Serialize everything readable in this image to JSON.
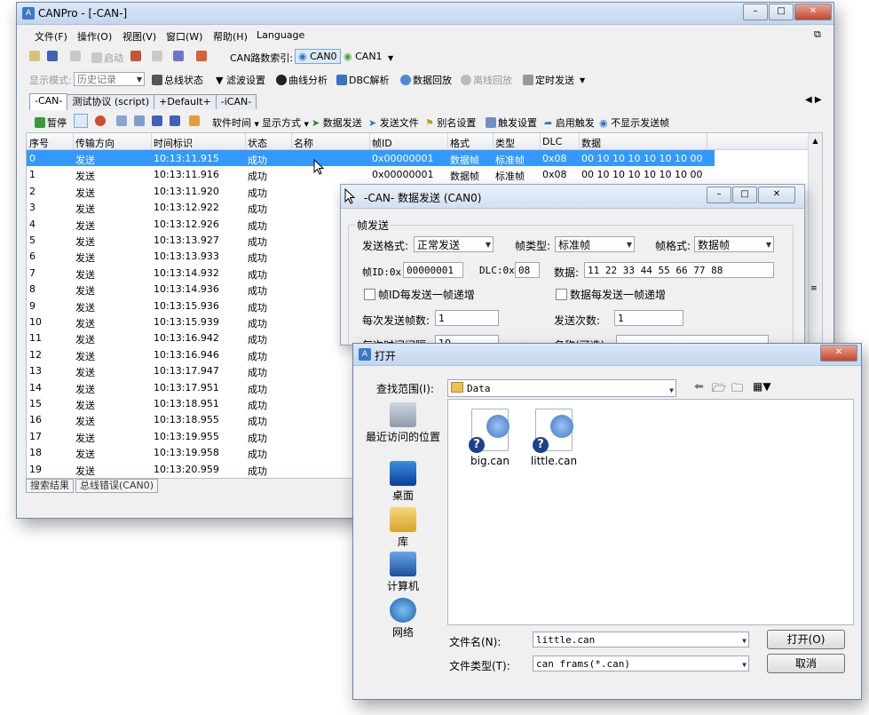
{
  "main": {
    "title": "CANPro - [-CAN-]",
    "menu": [
      "文件(F)",
      "操作(O)",
      "视图(V)",
      "窗口(W)",
      "帮助(H)",
      "Language"
    ],
    "toolbar1": {
      "start": "启动",
      "can_index_label": "CAN路数索引:",
      "can0": "CAN0",
      "can1": "CAN1"
    },
    "toolbar2": {
      "display_mode_label": "显示模式:",
      "display_mode_value": "历史记录",
      "bus_status": "总线状态",
      "filter": "滤波设置",
      "curve": "曲线分析",
      "dbc": "DBC解析",
      "replay": "数据回放",
      "offline_replay": "离线回放",
      "timed_send": "定时发送"
    },
    "tabs": [
      "-CAN-",
      "测试协议 (script)",
      "+Default+",
      "-iCAN-"
    ],
    "toolbar3": {
      "pause": "暂停",
      "soft_time": "软件时间",
      "display_style": "显示方式",
      "send_data": "数据发送",
      "send_file": "发送文件",
      "alias": "别名设置",
      "trigger": "触发设置",
      "enable_trigger": "启用触发",
      "hide_send": "不显示发送帧"
    },
    "columns": [
      "序号",
      "传输方向",
      "时间标识",
      "状态",
      "名称",
      "帧ID",
      "格式",
      "类型",
      "DLC",
      "数据"
    ],
    "rows": [
      {
        "no": "0",
        "dir": "发送",
        "time": "10:13:11.915",
        "status": "成功",
        "id": "0x00000001",
        "fmt": "数据帧",
        "type": "标准帧",
        "dlc": "0x08",
        "data": "00 10 10 10 10 10 10 00"
      },
      {
        "no": "1",
        "dir": "发送",
        "time": "10:13:11.916",
        "status": "成功",
        "id": "0x00000001",
        "fmt": "数据帧",
        "type": "标准帧",
        "dlc": "0x08",
        "data": "00 10 10 10 10 10 10 00"
      },
      {
        "no": "2",
        "dir": "发送",
        "time": "10:13:11.920",
        "status": "成功"
      },
      {
        "no": "3",
        "dir": "发送",
        "time": "10:13:12.922",
        "status": "成功"
      },
      {
        "no": "4",
        "dir": "发送",
        "time": "10:13:12.926",
        "status": "成功"
      },
      {
        "no": "5",
        "dir": "发送",
        "time": "10:13:13.927",
        "status": "成功"
      },
      {
        "no": "6",
        "dir": "发送",
        "time": "10:13:13.933",
        "status": "成功"
      },
      {
        "no": "7",
        "dir": "发送",
        "time": "10:13:14.932",
        "status": "成功"
      },
      {
        "no": "8",
        "dir": "发送",
        "time": "10:13:14.936",
        "status": "成功"
      },
      {
        "no": "9",
        "dir": "发送",
        "time": "10:13:15.936",
        "status": "成功"
      },
      {
        "no": "10",
        "dir": "发送",
        "time": "10:13:15.939",
        "status": "成功"
      },
      {
        "no": "11",
        "dir": "发送",
        "time": "10:13:16.942",
        "status": "成功"
      },
      {
        "no": "12",
        "dir": "发送",
        "time": "10:13:16.946",
        "status": "成功"
      },
      {
        "no": "13",
        "dir": "发送",
        "time": "10:13:17.947",
        "status": "成功"
      },
      {
        "no": "14",
        "dir": "发送",
        "time": "10:13:17.951",
        "status": "成功"
      },
      {
        "no": "15",
        "dir": "发送",
        "time": "10:13:18.951",
        "status": "成功"
      },
      {
        "no": "16",
        "dir": "发送",
        "time": "10:13:18.955",
        "status": "成功"
      },
      {
        "no": "17",
        "dir": "发送",
        "time": "10:13:19.955",
        "status": "成功"
      },
      {
        "no": "18",
        "dir": "发送",
        "time": "10:13:19.958",
        "status": "成功"
      },
      {
        "no": "19",
        "dir": "发送",
        "time": "10:13:20.959",
        "status": "成功"
      }
    ],
    "bottom_tabs": [
      "搜索结果",
      "总线错误(CAN0)"
    ]
  },
  "send_dialog": {
    "title": "-CAN- 数据发送 (CAN0)",
    "group": "帧发送",
    "send_format_label": "发送格式:",
    "send_format": "正常发送",
    "frame_type_label": "帧类型:",
    "frame_type": "标准帧",
    "frame_format_label": "帧格式:",
    "frame_format": "数据帧",
    "frame_id_label": "帧ID:0x",
    "frame_id": "00000001",
    "dlc_label": "DLC:0x",
    "dlc": "08",
    "data_label": "数据:",
    "data": "11 22 33 44 55 66 77 88",
    "inc_id": "帧ID每发送一帧递增",
    "inc_data": "数据每发送一帧递增",
    "frames_per_send_label": "每次发送帧数:",
    "frames_per_send": "1",
    "send_count_label": "发送次数:",
    "send_count": "1",
    "interval_label": "每次时间间隔:",
    "interval": "10",
    "name_label": "名称(可选):"
  },
  "open_dialog": {
    "title": "打开",
    "look_in_label": "查找范围(I):",
    "look_in": "Data",
    "places": [
      "最近访问的位置",
      "桌面",
      "库",
      "计算机",
      "网络"
    ],
    "files": [
      "big.can",
      "little.can"
    ],
    "filename_label": "文件名(N):",
    "filename": "little.can",
    "filetype_label": "文件类型(T):",
    "filetype": "can frams(*.can)",
    "open_btn": "打开(O)",
    "cancel_btn": "取消"
  }
}
